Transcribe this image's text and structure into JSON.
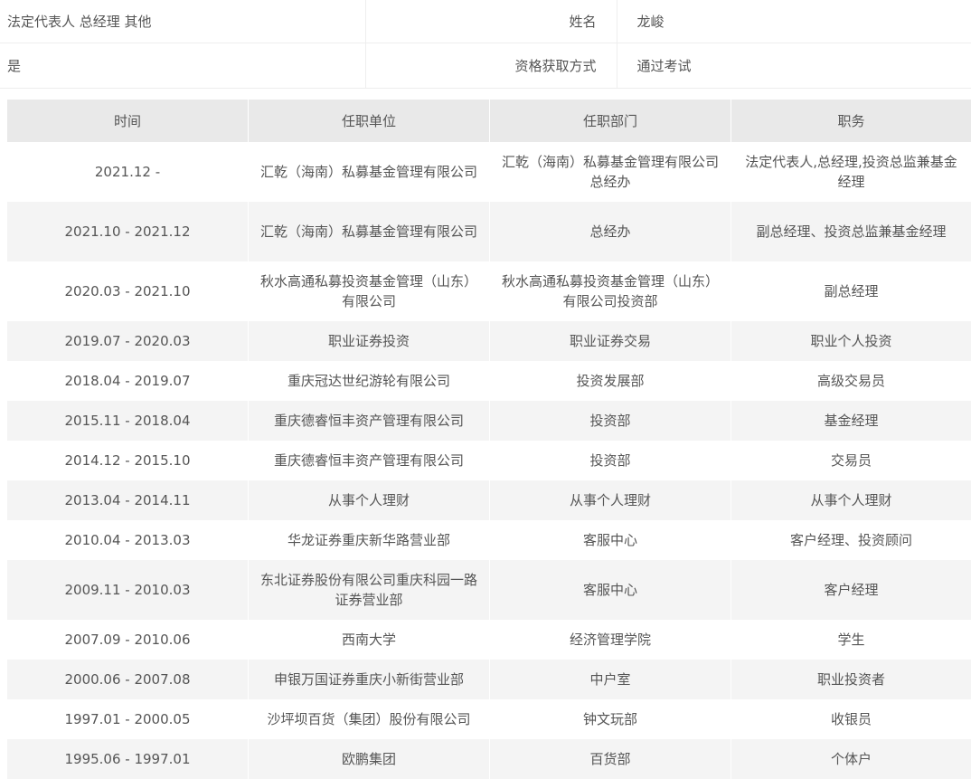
{
  "info": {
    "row1": {
      "value_left": "法定代表人 总经理 其他",
      "label": "姓名",
      "value_right": "龙峻"
    },
    "row2": {
      "value_left": "是",
      "label": "资格获取方式",
      "value_right": "通过考试"
    }
  },
  "career": {
    "headers": [
      "时间",
      "任职单位",
      "任职部门",
      "职务"
    ],
    "rows": [
      {
        "time": "2021.12 -",
        "company": "汇乾（海南）私募基金管理有限公司",
        "department": "汇乾（海南）私募基金管理有限公司总经办",
        "position": "法定代表人,总经理,投资总监兼基金经理"
      },
      {
        "time": "2021.10 - 2021.12",
        "company": "汇乾（海南）私募基金管理有限公司",
        "department": "总经办",
        "position": "副总经理、投资总监兼基金经理"
      },
      {
        "time": "2020.03 - 2021.10",
        "company": "秋水高通私募投资基金管理（山东）有限公司",
        "department": "秋水高通私募投资基金管理（山东）有限公司投资部",
        "position": "副总经理"
      },
      {
        "time": "2019.07 - 2020.03",
        "company": "职业证券投资",
        "department": "职业证券交易",
        "position": "职业个人投资"
      },
      {
        "time": "2018.04 - 2019.07",
        "company": "重庆冠达世纪游轮有限公司",
        "department": "投资发展部",
        "position": "高级交易员"
      },
      {
        "time": "2015.11 - 2018.04",
        "company": "重庆德睿恒丰资产管理有限公司",
        "department": "投资部",
        "position": "基金经理"
      },
      {
        "time": "2014.12 - 2015.10",
        "company": "重庆德睿恒丰资产管理有限公司",
        "department": "投资部",
        "position": "交易员"
      },
      {
        "time": "2013.04 - 2014.11",
        "company": "从事个人理财",
        "department": "从事个人理财",
        "position": "从事个人理财"
      },
      {
        "time": "2010.04 - 2013.03",
        "company": "华龙证券重庆新华路营业部",
        "department": "客服中心",
        "position": "客户经理、投资顾问"
      },
      {
        "time": "2009.11 - 2010.03",
        "company": "东北证券股份有限公司重庆科园一路证券营业部",
        "department": "客服中心",
        "position": "客户经理"
      },
      {
        "time": "2007.09 - 2010.06",
        "company": "西南大学",
        "department": "经济管理学院",
        "position": "学生"
      },
      {
        "time": "2000.06 - 2007.08",
        "company": "申银万国证券重庆小新街营业部",
        "department": "中户室",
        "position": "职业投资者"
      },
      {
        "time": "1997.01 - 2000.05",
        "company": "沙坪坝百货（集团）股份有限公司",
        "department": "钟文玩部",
        "position": "收银员"
      },
      {
        "time": "1995.06 - 1997.01",
        "company": "欧鹏集团",
        "department": "百货部",
        "position": "个体户"
      }
    ]
  }
}
